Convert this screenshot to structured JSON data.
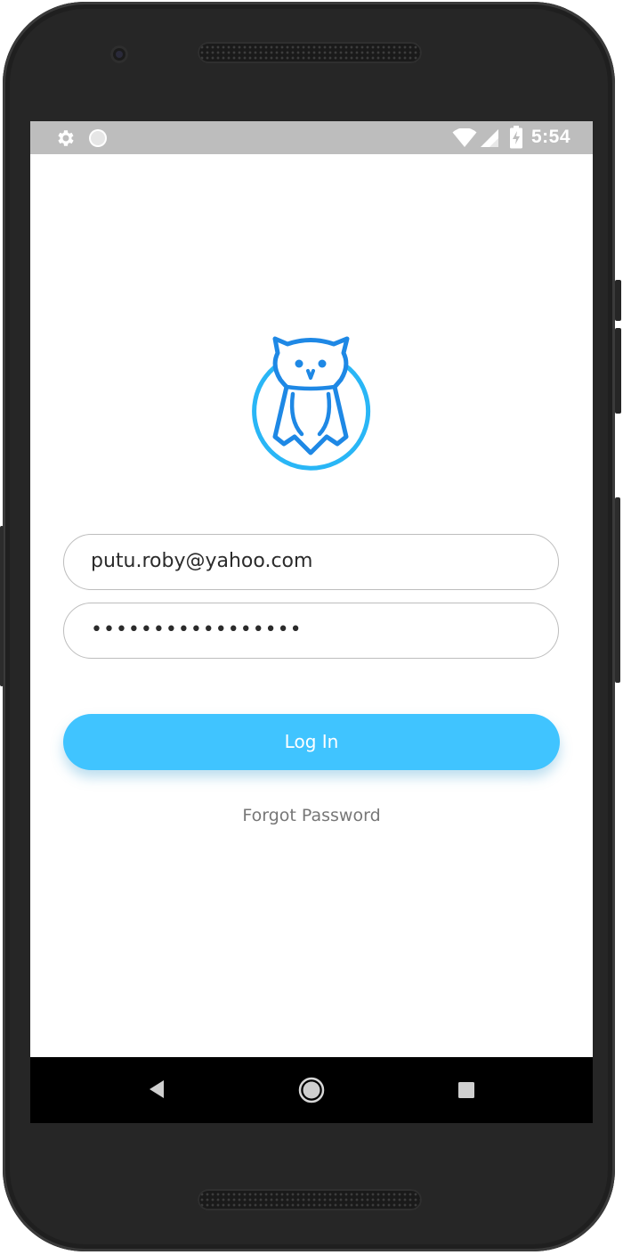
{
  "status_bar": {
    "time": "5:54",
    "icons": [
      "settings-icon",
      "circle-notification-icon",
      "wifi-icon",
      "signal-icon",
      "battery-charging-icon"
    ]
  },
  "login": {
    "logo": "owl-logo-icon",
    "email_value": "putu.roby@yahoo.com",
    "password_value": "•••••••••••••••••",
    "login_label": "Log In",
    "forgot_label": "Forgot Password"
  },
  "nav_bar": {
    "icons": [
      "back-icon",
      "home-icon",
      "recents-icon"
    ]
  },
  "colors": {
    "accent": "#40c4ff",
    "logo_blue": "#29a8f0",
    "status_bar": "#bdbdbd",
    "field_border": "#bdbdbd",
    "forgot_text": "#777777",
    "phone_body": "#262626"
  }
}
